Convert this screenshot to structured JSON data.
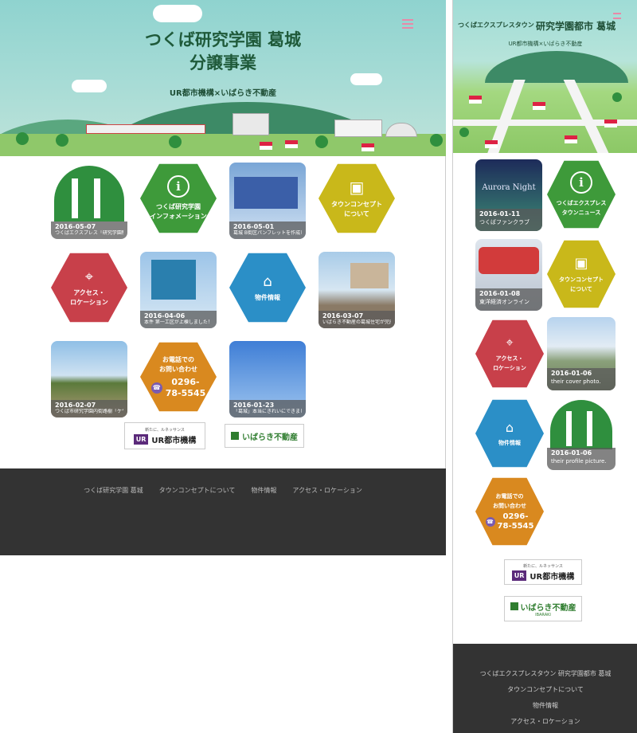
{
  "desktop": {
    "title_line1": "つくば研究学園 葛城",
    "title_line2": "分譲事業",
    "subtitle": "UR都市機構×いばらき不動産",
    "tiles": {
      "t1": {
        "date": "2016-05-07",
        "text": "つくばエクスプレス「研究学園駅」徒歩..."
      },
      "t2": {
        "label1": "つくば研究学園",
        "label2": "インフォメーション"
      },
      "t3": {
        "date": "2016-05-01",
        "text": "葛城 B街区パンフレットを作成しました..."
      },
      "t4": {
        "label1": "タウンコンセプト",
        "label2": "について"
      },
      "t5": {
        "label1": "アクセス・",
        "label2": "ロケーション"
      },
      "t6": {
        "date": "2016-04-06",
        "text": "本件 第一工区が上棟しました！ いばら..."
      },
      "t7": {
        "label1": "物件情報"
      },
      "t8": {
        "date": "2016-03-07",
        "text": "いばらき不動産の葛城住宅が完成しまし..."
      },
      "t9": {
        "date": "2016-02-07",
        "text": "つくば市研究学園内街路樹「ケヤキ」..."
      },
      "t10": {
        "label1": "お電話での",
        "label2": "お問い合わせ",
        "phone1": "0296-",
        "phone2": "78-5545"
      },
      "t11": {
        "date": "2016-01-23",
        "text": "「葛城」本当にきれいにできました！"
      }
    },
    "logos": {
      "ur_tag": "新たに、ルネッサンス",
      "ur_mark": "UR",
      "ur_text": "UR都市機構",
      "ibaraki_text": "いばらき不動産"
    },
    "footer": [
      "つくば研究学園 葛城",
      "タウンコンセプトについて",
      "物件情報",
      "アクセス・ロケーション"
    ]
  },
  "mobile": {
    "title_small": "つくばエクスプレスタウン",
    "title_big": "研究学園都市 葛城",
    "subtitle": "UR都市機構×いばらき不動産",
    "tiles": {
      "m1": {
        "image_text": "Aurora Night",
        "date": "2016-01-11",
        "text": "つくばファンクラブ"
      },
      "m2": {
        "label1": "つくばエクスプレス",
        "label2": "タウンニュース"
      },
      "m3": {
        "date": "2016-01-08",
        "text": "東洋経済オンライン"
      },
      "m4": {
        "label1": "タウンコンセプト",
        "label2": "について"
      },
      "m5": {
        "label1": "アクセス・",
        "label2": "ロケーション"
      },
      "m6": {
        "date": "2016-01-06",
        "text": "their cover photo."
      },
      "m7": {
        "label1": "物件情報"
      },
      "m8": {
        "date": "2016-01-06",
        "text": "their profile picture."
      },
      "m9": {
        "label1": "お電話での",
        "label2": "お問い合わせ",
        "phone1": "0296-",
        "phone2": "78-5545"
      }
    },
    "logos": {
      "ur_tag": "新たに、ルネッサンス",
      "ur_mark": "UR",
      "ur_text": "UR都市機構",
      "ibaraki_text": "いばらき不動産",
      "ibaraki_en": "IBARAKI"
    },
    "footer": [
      "つくばエクスプレスタウン 研究学園都市 葛城",
      "タウンコンセプトについて",
      "物件情報",
      "アクセス・ロケーション"
    ]
  },
  "colors": {
    "hex_green": "#3e9a3a",
    "hex_yellow": "#c9b81a",
    "hex_red": "#c8404a",
    "hex_blue": "#2b8fc7",
    "hex_orange": "#d9891f",
    "footer_bg": "#333333"
  },
  "icons": {
    "info": "info-icon",
    "concept": "building-icon",
    "access": "map-pin-icon",
    "property": "house-search-icon",
    "phone": "phone-icon",
    "menu": "hamburger-icon"
  }
}
